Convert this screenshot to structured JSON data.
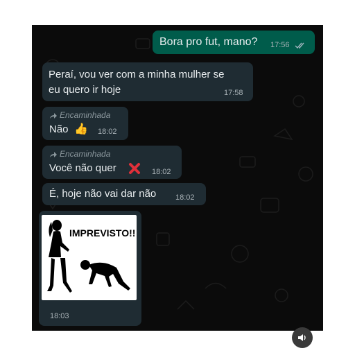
{
  "colors": {
    "chat_background": "#0b0b0b",
    "incoming_bubble": "#1f2c33",
    "outgoing_bubble": "#005c4b",
    "text": "#e9edef",
    "time": "#aab3b8",
    "read_ticks": "#9fb4bd",
    "forward_label": "#8a969c",
    "reject_mark": "#e0303a"
  },
  "messages": [
    {
      "direction": "outgoing",
      "text": "Bora pro fut, mano?",
      "time": "17:56",
      "status_icon": "double-check-icon"
    },
    {
      "direction": "incoming",
      "line1": "Peraí, vou ver com a minha mulher se",
      "line2": "eu quero ir hoje",
      "time": "17:58"
    },
    {
      "direction": "incoming",
      "forward_label": "Encaminhada",
      "text": "Não",
      "emoji": "👍",
      "time": "18:02"
    },
    {
      "direction": "incoming",
      "forward_label": "Encaminhada",
      "text": "Você não quer",
      "emoji_icon": "cross-mark-icon",
      "time": "18:02"
    },
    {
      "direction": "incoming",
      "text": "É, hoje não vai dar não",
      "time": "18:02"
    },
    {
      "direction": "incoming",
      "type": "image",
      "image_caption": "IMPREVISTO!!",
      "time": "18:03"
    }
  ],
  "controls": {
    "sound_icon": "speaker-icon"
  }
}
